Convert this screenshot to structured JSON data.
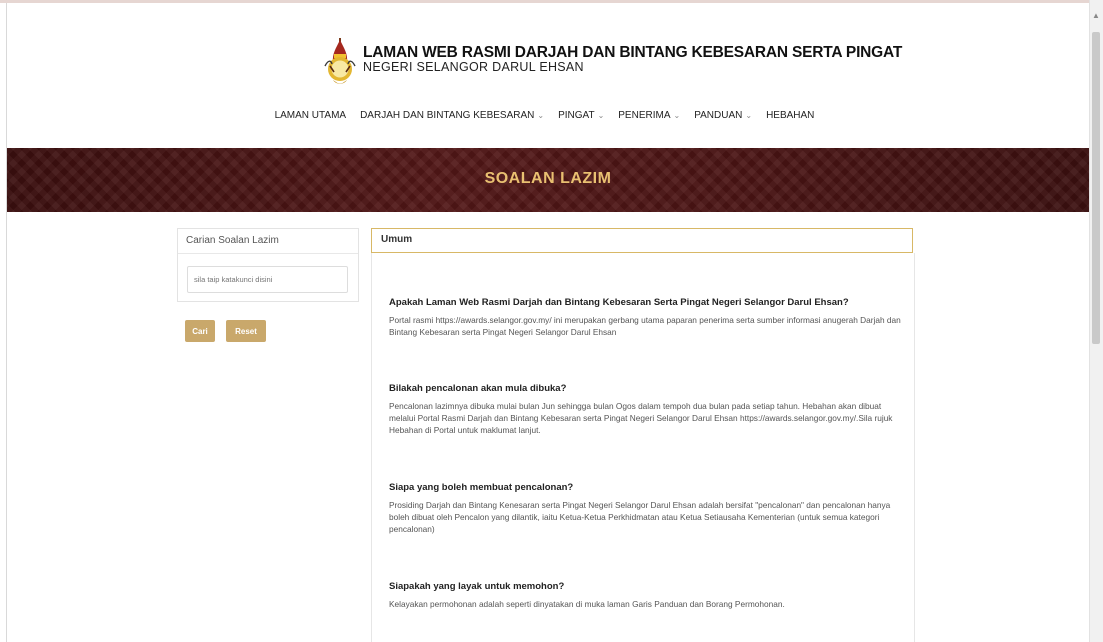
{
  "header": {
    "title": "LAMAN WEB RASMI DARJAH DAN BINTANG KEBESARAN SERTA PINGAT",
    "subtitle": "NEGERI SELANGOR DARUL EHSAN",
    "logo_icon": "selangor-crest-icon"
  },
  "nav": {
    "items": [
      {
        "label": "LAMAN UTAMA",
        "dropdown": false
      },
      {
        "label": "DARJAH DAN BINTANG KEBESARAN",
        "dropdown": true
      },
      {
        "label": "PINGAT",
        "dropdown": true
      },
      {
        "label": "PENERIMA",
        "dropdown": true
      },
      {
        "label": "PANDUAN",
        "dropdown": true
      },
      {
        "label": "HEBAHAN",
        "dropdown": false
      }
    ]
  },
  "banner": {
    "title": "SOALAN LAZIM"
  },
  "search": {
    "heading": "Carian Soalan Lazim",
    "placeholder": "sila taip katakunci disini",
    "search_label": "Cari",
    "reset_label": "Reset"
  },
  "faq": {
    "category": "Umum",
    "items": [
      {
        "question": "Apakah Laman Web Rasmi Darjah dan Bintang Kebesaran Serta Pingat Negeri Selangor Darul Ehsan?",
        "answer": "Portal rasmi https://awards.selangor.gov.my/ ini merupakan gerbang utama paparan penerima serta sumber informasi anugerah Darjah dan Bintang Kebesaran serta Pingat Negeri Selangor Darul Ehsan"
      },
      {
        "question": "Bilakah pencalonan akan mula dibuka?",
        "answer": "Pencalonan lazimnya dibuka mulai bulan Jun sehingga bulan Ogos dalam tempoh dua bulan pada setiap tahun. Hebahan akan dibuat melalui Portal Rasmi Darjah dan Bintang Kebesaran serta Pingat Negeri Selangor Darul Ehsan https://awards.selangor.gov.my/.Sila rujuk Hebahan di Portal untuk maklumat lanjut."
      },
      {
        "question": "Siapa yang boleh membuat pencalonan?",
        "answer": "Prosiding Darjah dan Bintang Kenesaran serta Pingat Negeri Selangor Darul Ehsan adalah bersifat \"pencalonan\" dan pencalonan hanya boleh dibuat oleh Pencalon yang dilantik, iaitu Ketua-Ketua Perkhidmatan atau Ketua Setiausaha Kementerian (untuk semua kategori pencalonan)"
      },
      {
        "question": "Siapakah yang layak untuk memohon?",
        "answer": "Kelayakan permohonan adalah seperti dinyatakan di muka laman Garis Panduan dan Borang Permohonan."
      }
    ]
  },
  "colors": {
    "banner": "#4a1414",
    "banner_text": "#e9c071",
    "button": "#c9a86b",
    "category_border": "#d8b866"
  }
}
